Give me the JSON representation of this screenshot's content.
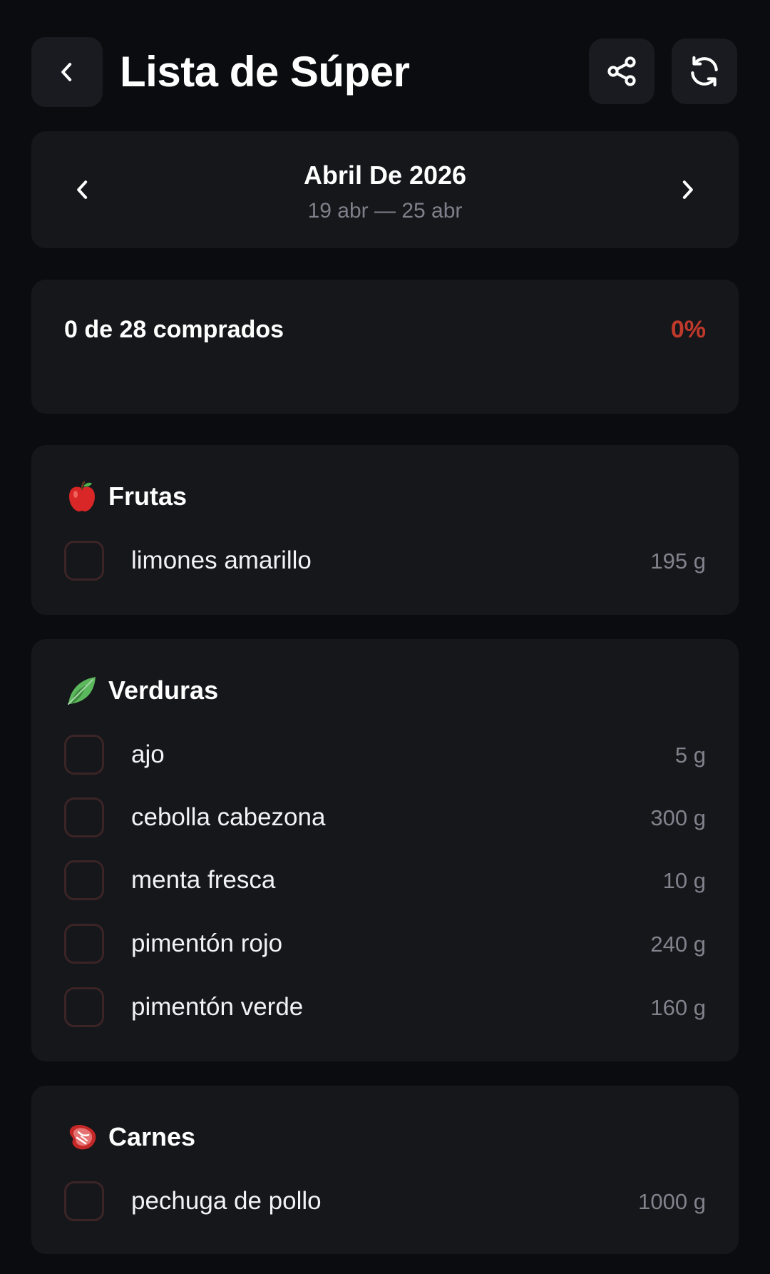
{
  "header": {
    "title": "Lista de Súper",
    "back_icon": "chevron-left-icon",
    "share_icon": "share-icon",
    "refresh_icon": "refresh-icon"
  },
  "week": {
    "title": "Abril De 2026",
    "range": "19 abr — 25 abr"
  },
  "progress": {
    "text": "0 de 28 comprados",
    "percent_label": "0%",
    "fraction": 0,
    "accent_color": "#c0392b"
  },
  "categories": [
    {
      "name": "Frutas",
      "icon": "apple-icon",
      "items": [
        {
          "name": "limones amarillo",
          "qty": "195 g"
        }
      ]
    },
    {
      "name": "Verduras",
      "icon": "leafy-green-icon",
      "items": [
        {
          "name": "ajo",
          "qty": "5 g"
        },
        {
          "name": "cebolla cabezona",
          "qty": "300 g"
        },
        {
          "name": "menta fresca",
          "qty": "10 g"
        },
        {
          "name": "pimentón rojo",
          "qty": "240 g"
        },
        {
          "name": "pimentón verde",
          "qty": "160 g"
        }
      ]
    },
    {
      "name": "Carnes",
      "icon": "steak-icon",
      "items": [
        {
          "name": "pechuga de pollo",
          "qty": "1000 g"
        }
      ]
    }
  ]
}
